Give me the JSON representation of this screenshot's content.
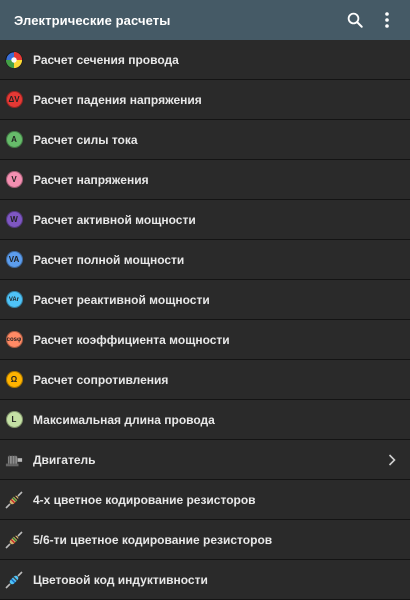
{
  "app": {
    "title": "Электрические расчеты",
    "search_icon": "search-icon",
    "more_icon": "more-vert-icon"
  },
  "items": [
    {
      "label": "Расчет сечения провода",
      "icon": "wire-section-icon",
      "glyph": "",
      "color": "#4caf50"
    },
    {
      "label": "Расчет падения напряжения",
      "icon": "voltage-drop-icon",
      "glyph": "ΔV",
      "color": "#e53935"
    },
    {
      "label": "Расчет силы тока",
      "icon": "current-icon",
      "glyph": "A",
      "color": "#66bb6a"
    },
    {
      "label": "Расчет напряжения",
      "icon": "voltage-icon",
      "glyph": "V",
      "color": "#f48fb1"
    },
    {
      "label": "Расчет активной мощности",
      "icon": "active-power-icon",
      "glyph": "W",
      "color": "#7e57c2"
    },
    {
      "label": "Расчет полной мощности",
      "icon": "apparent-power-icon",
      "glyph": "VA",
      "color": "#5c9ded"
    },
    {
      "label": "Расчет реактивной мощности",
      "icon": "reactive-power-icon",
      "glyph": "VAr",
      "color": "#4fc3f7"
    },
    {
      "label": "Расчет коэффициента мощности",
      "icon": "power-factor-icon",
      "glyph": "cosφ",
      "color": "#ff8a65"
    },
    {
      "label": "Расчет сопротивления",
      "icon": "resistance-icon",
      "glyph": "Ω",
      "color": "#ffb300"
    },
    {
      "label": "Максимальная длина провода",
      "icon": "max-wire-length-icon",
      "glyph": "L",
      "color": "#c5e1a5"
    },
    {
      "label": "Двигатель",
      "icon": "motor-icon",
      "glyph": "",
      "color": "#9e9e9e",
      "chevron": true
    },
    {
      "label": "4-х цветное кодирование резисторов",
      "icon": "resistor-icon",
      "glyph": "",
      "color": "#d4b06a"
    },
    {
      "label": "5/6-ти цветное кодирование резисторов",
      "icon": "resistor-icon",
      "glyph": "",
      "color": "#d4b06a"
    },
    {
      "label": "Цветовой код индуктивности",
      "icon": "inductor-icon",
      "glyph": "",
      "color": "#4fc3f7"
    }
  ]
}
